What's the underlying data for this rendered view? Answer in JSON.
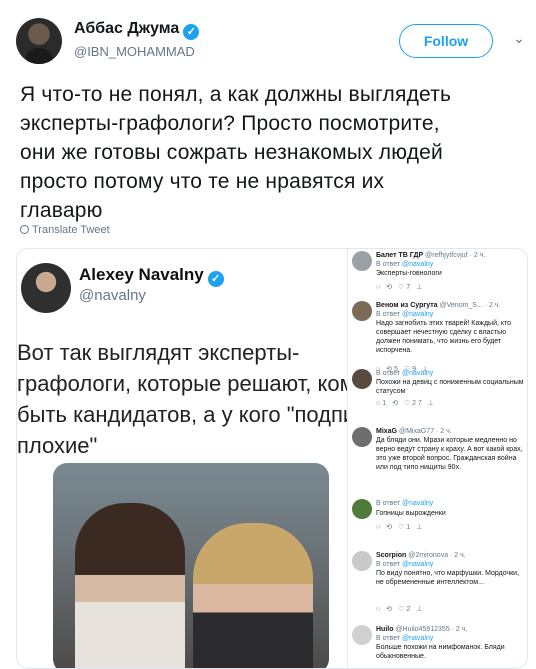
{
  "author": {
    "name": "Аббас Джума",
    "handle": "@IBN_MOHAMMAD",
    "follow_label": "Follow"
  },
  "tweet": {
    "text_lines": [
      "Я что-то не понял, а как должны выглядеть",
      "эксперты-графологи? Просто посмотрите,",
      "они же готовы сожрать незнакомых людей",
      "просто потому что те не нравятся их",
      "главарю"
    ],
    "translate_label": "Translate Tweet"
  },
  "embedded": {
    "name": "Alexey Navalny",
    "handle": "@navalny",
    "text_lines": [
      "Вот так выглядят эксперты-",
      "графологи, которые решают, кому",
      "быть кандидатов, а у кого \"подпис",
      "плохие\""
    ]
  },
  "replies": [
    {
      "name": "Балет ТВ ГДР",
      "meta": "@refhjytfcvjuf · 2 ч.",
      "reply_to": "@navalny",
      "text": "Эксперты-говнологи",
      "icons": "○  ⟲  ♡7  ⊥"
    },
    {
      "name": "Веном из Сургута",
      "meta": "@Venom_S... · 2 ч.",
      "reply_to": "@navalny",
      "text": "Надо загнобить этих тварей! Каждый, кто совершает нечестную сделку с властью должен понимать, что жизнь его будет испорчена.",
      "icons": "○  ⟲5  ♡9  ⊥"
    },
    {
      "name": "",
      "meta": "",
      "reply_to": "@navalny",
      "text": "Похожи на девиц с пониженным социальным статусом",
      "icons": "○1  ⟲  ♡27  ⊥"
    },
    {
      "name": "МіхаG",
      "meta": "@MixaG77 · 2 ч.",
      "reply_to": "",
      "text": "Да бляди они. Мрази которые медленно но верно ведут страну к краху. А вот какой крах, это уже второй вопрос. Гражданская война или под типо нищиты 90х.",
      "icons": ""
    },
    {
      "name": "",
      "meta": "",
      "reply_to": "@navalny",
      "text": "Гопницы вырожденки",
      "icons": "○  ⟲  ♡1  ⊥"
    },
    {
      "name": "Scorpion",
      "meta": "@2mironova · 2 ч.",
      "reply_to": "@navalny",
      "text": "По виду понятно, что марфушки. Мордочки, не обремененные интеллектом...",
      "icons": "○  ⟲  ♡2  ⊥"
    },
    {
      "name": "Huilo",
      "meta": "@Huilo45912355 · 2 ч.",
      "reply_to": "@navalny",
      "text": "Больше похожи на нимфоманок. Бляди обыкновенные.",
      "icons": ""
    }
  ],
  "reply_prefix": "В ответ"
}
